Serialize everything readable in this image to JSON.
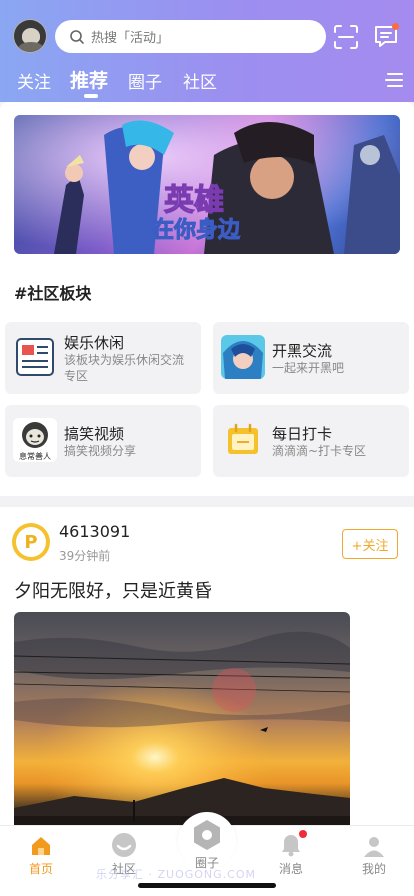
{
  "header": {
    "search_placeholder": "热搜「活动」",
    "tabs": [
      {
        "label": "关注"
      },
      {
        "label": "推荐"
      },
      {
        "label": "圈子"
      },
      {
        "label": "社区"
      }
    ],
    "active_tab": "推荐",
    "icons": [
      "avatar",
      "search-icon",
      "scan-icon",
      "message-icon",
      "menu-icon"
    ]
  },
  "banner": {
    "caption": "英雄 在你身边"
  },
  "section": {
    "title": "#社区板块"
  },
  "boards": [
    {
      "name": "娱乐休闲",
      "desc": "该板块为娱乐休闲交流专区"
    },
    {
      "name": "开黑交流",
      "desc": "一起来开黑吧"
    },
    {
      "name": "搞笑视频",
      "desc": "搞笑视频分享"
    },
    {
      "name": "每日打卡",
      "desc": "滴滴滴~打卡专区"
    }
  ],
  "board_thumb_text": {
    "meme": "息常善人"
  },
  "post": {
    "username": "4613091",
    "time": "39分钟前",
    "follow_label": "+关注",
    "text": "夕阳无限好，只是近黄昏"
  },
  "tabbar": [
    {
      "label": "首页",
      "active": true
    },
    {
      "label": "社区"
    },
    {
      "label": "圈子"
    },
    {
      "label": "消息"
    },
    {
      "label": "我的"
    }
  ],
  "watermark": "乐分享汇 · ZUOGONG.COM",
  "colors": {
    "accent": "#f29a1e",
    "header_gradient_start": "#8aa7f2",
    "header_gradient_end": "#a58bef",
    "follow_border": "#f0a92c"
  }
}
